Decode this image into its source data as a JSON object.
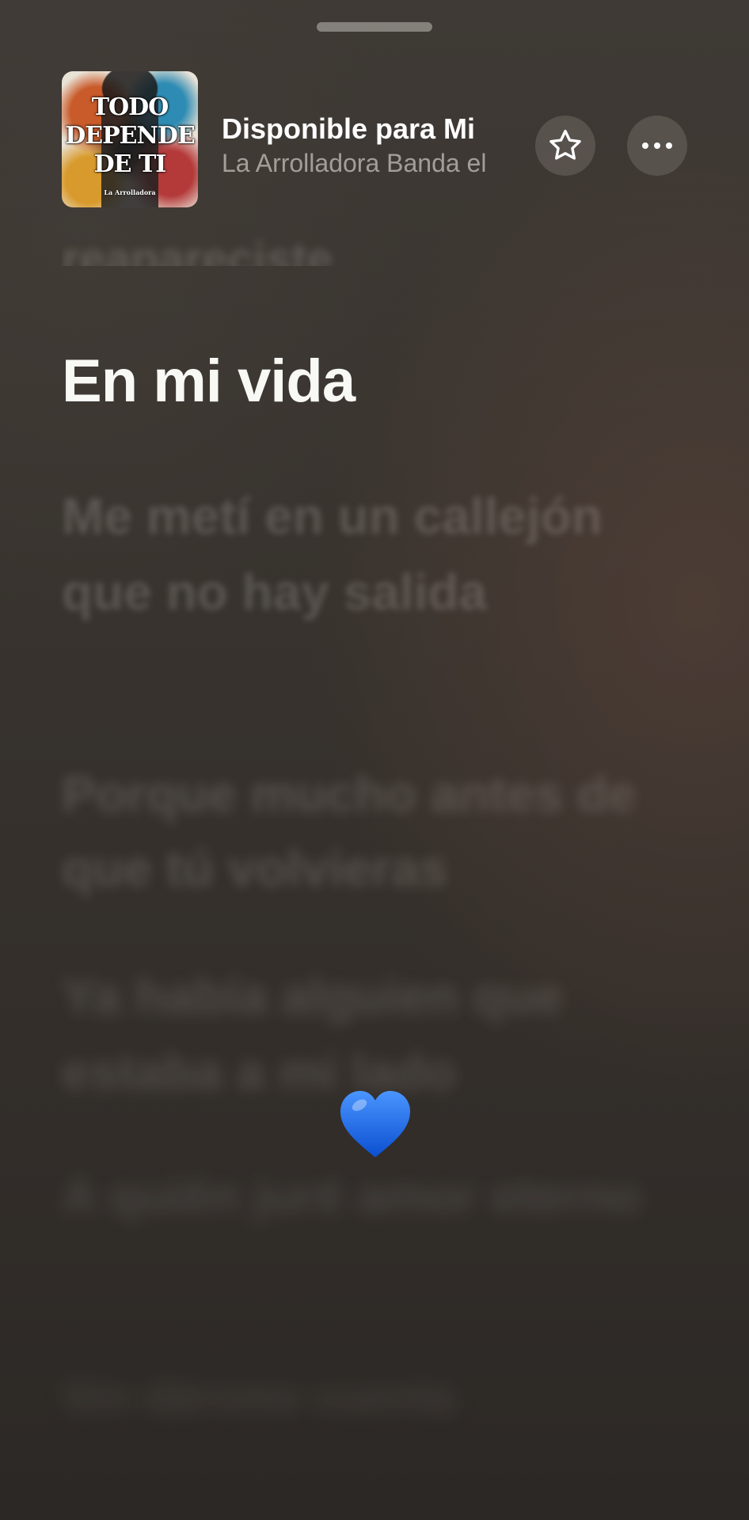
{
  "header": {
    "album_art": {
      "title": "TODO\nDEPENDE\nDE TI",
      "label": "La Arrolladora"
    },
    "track_title": "Disponible para Mi",
    "artist": "La Arrolladora Banda el",
    "star_icon": "star-outline-icon",
    "more_icon": "ellipsis-icon"
  },
  "lyrics": {
    "previous_partial": "reapareciste",
    "active": "En mi vida",
    "upcoming": [
      "Me metí en un callejón que no hay salida",
      "Porque mucho antes de que tú volvieras",
      "Ya había alguien que estaba a mi lado",
      "A quién juré amor eterno",
      "Sin dársme cuenta"
    ]
  },
  "overlay": {
    "emoji_icon": "blue-heart-icon",
    "color": "#1f6fe6"
  },
  "colors": {
    "background": "#38332e",
    "active_lyric": "#f8f8f4"
  }
}
